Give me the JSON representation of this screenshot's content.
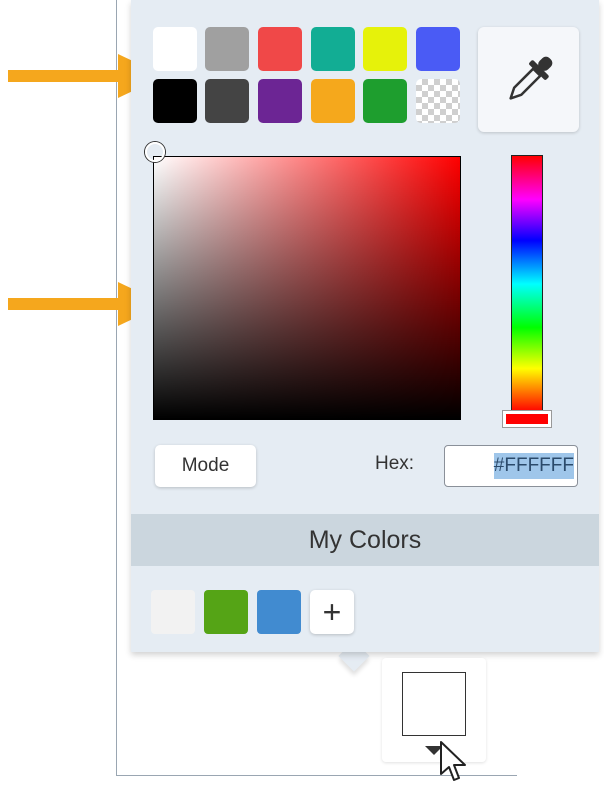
{
  "swatches": {
    "top_row": [
      {
        "name": "white",
        "color": "#ffffff"
      },
      {
        "name": "gray",
        "color": "#a0a0a0"
      },
      {
        "name": "red",
        "color": "#f04848"
      },
      {
        "name": "teal",
        "color": "#12ad94"
      },
      {
        "name": "yellow",
        "color": "#e6f20a"
      },
      {
        "name": "blue",
        "color": "#4a5bf5"
      }
    ],
    "bottom_row": [
      {
        "name": "black",
        "color": "#000000"
      },
      {
        "name": "dark-gray",
        "color": "#444444"
      },
      {
        "name": "purple",
        "color": "#6c2594"
      },
      {
        "name": "orange",
        "color": "#f5a81c"
      },
      {
        "name": "green",
        "color": "#1e9e2e"
      },
      {
        "name": "transparent",
        "color": "transparent"
      }
    ]
  },
  "eyedropper": {
    "icon": "eyedropper-icon"
  },
  "picker": {
    "hue_color": "#ff0000"
  },
  "mode_button": {
    "label": "Mode"
  },
  "hex": {
    "label": "Hex:",
    "value": "#FFFFFF"
  },
  "my_colors": {
    "title": "My Colors",
    "swatches": [
      {
        "name": "off-white",
        "color": "#f2f2f2"
      },
      {
        "name": "green",
        "color": "#55a416"
      },
      {
        "name": "blue",
        "color": "#418bd0"
      }
    ],
    "add_label": "+"
  },
  "current_color": {
    "color": "#ffffff"
  },
  "annotations": {
    "arrow_color": "#f5a71d"
  }
}
